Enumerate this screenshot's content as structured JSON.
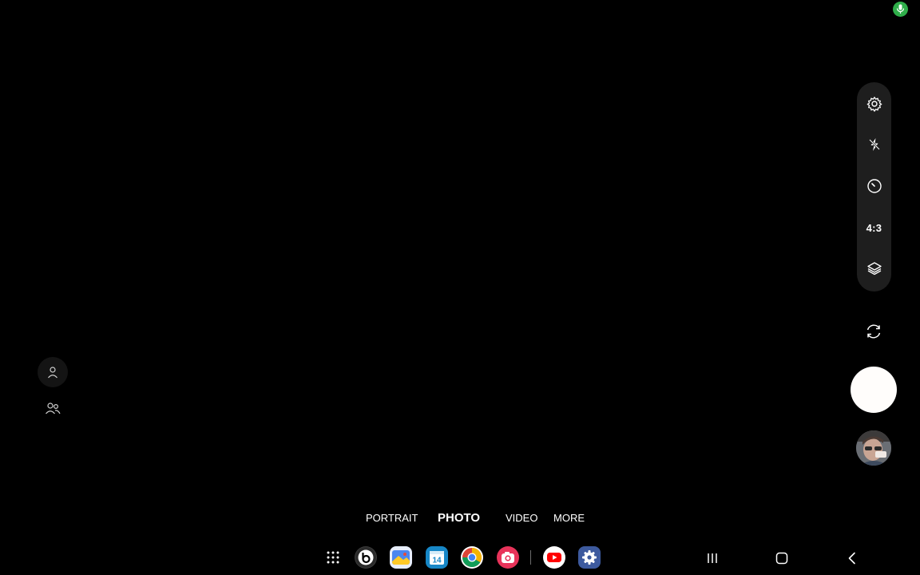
{
  "status": {
    "mic_icon": "microphone-icon",
    "mic_color": "#2fae4a"
  },
  "settings_bar": {
    "icons": [
      "gear-icon",
      "flash-off-icon",
      "timer-icon",
      "layers-icon"
    ],
    "aspect_ratio": "4:3"
  },
  "controls": {
    "switch_camera_icon": "rotate-camera-icon",
    "shutter_color": "#fffdfb",
    "gallery": "gallery-thumbnail"
  },
  "left_controls": {
    "single_icon": "person-icon",
    "group_icon": "people-icon"
  },
  "modes": {
    "items": [
      "PORTRAIT",
      "PHOTO",
      "VIDEO",
      "MORE"
    ],
    "active": "PHOTO"
  },
  "taskbar": {
    "apps": [
      "app-drawer-icon",
      "beats-icon",
      "gallery-icon",
      "calendar-icon",
      "chrome-icon",
      "camera-icon",
      "youtube-icon",
      "settings-icon"
    ],
    "calendar_day": "14"
  },
  "navigation": [
    "recents-icon",
    "home-icon",
    "back-icon"
  ]
}
